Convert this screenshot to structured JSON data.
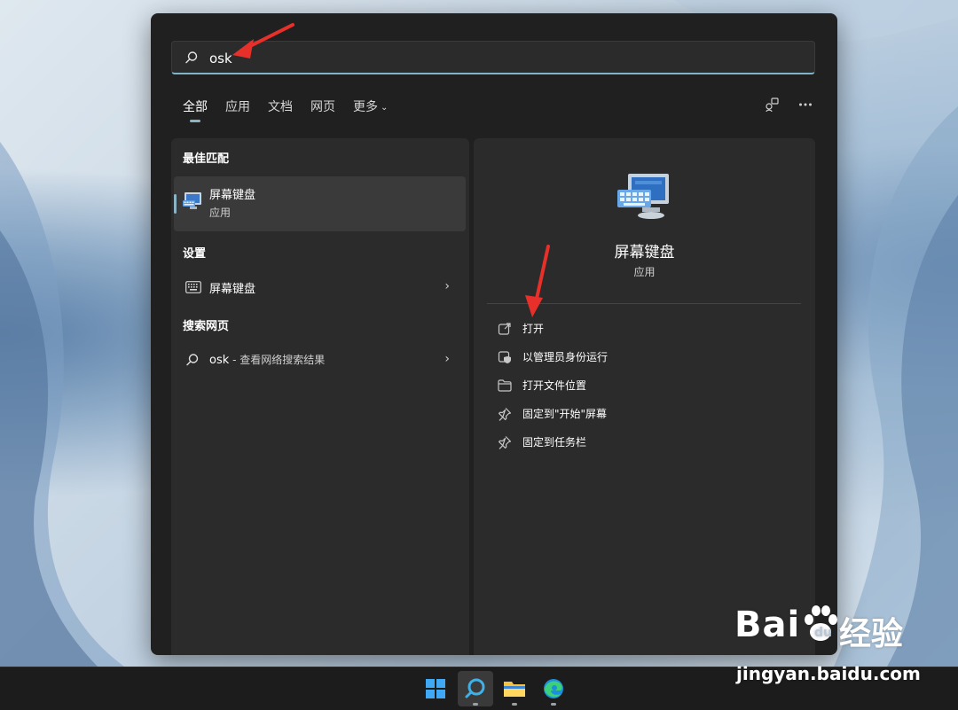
{
  "search": {
    "query": "osk"
  },
  "tabs": [
    {
      "label": "全部",
      "active": true
    },
    {
      "label": "应用",
      "active": false
    },
    {
      "label": "文档",
      "active": false
    },
    {
      "label": "网页",
      "active": false
    },
    {
      "label": "更多",
      "active": false
    }
  ],
  "sections": {
    "best_match": "最佳匹配",
    "settings": "设置",
    "web": "搜索网页"
  },
  "best_match": {
    "name": "屏幕键盘",
    "type": "应用"
  },
  "settings_item": {
    "label": "屏幕键盘"
  },
  "web_item": {
    "query": "osk",
    "suffix": " - 查看网络搜索结果"
  },
  "detail": {
    "name": "屏幕键盘",
    "type": "应用",
    "actions": [
      {
        "label": "打开",
        "icon": "open-external-icon"
      },
      {
        "label": "以管理员身份运行",
        "icon": "admin-shield-icon"
      },
      {
        "label": "打开文件位置",
        "icon": "folder-icon"
      },
      {
        "label": "固定到\"开始\"屏幕",
        "icon": "pin-icon"
      },
      {
        "label": "固定到任务栏",
        "icon": "pin-icon"
      }
    ]
  },
  "watermark": {
    "brand": "Bai",
    "brand_cn": "经验",
    "url": "jingyan.baidu.com"
  },
  "colors": {
    "accent": "#8ab4c6",
    "panel": "#202020",
    "card": "#2b2b2b",
    "arrow": "#e8302a"
  }
}
